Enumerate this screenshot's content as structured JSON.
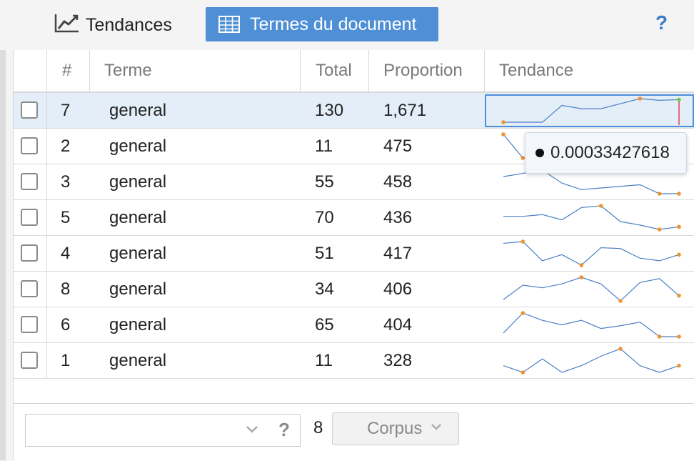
{
  "toolbar": {
    "trend_tab_label": "Tendances",
    "terms_tab_label": "Termes du document",
    "help_label": "?"
  },
  "grid": {
    "columns": [
      "#",
      "Terme",
      "Total",
      "Proportion",
      "Tendance"
    ],
    "rows": [
      {
        "index": "7",
        "term": "general",
        "total": "130",
        "proportion": "1,671",
        "selected": true,
        "trend": [
          0.0002,
          0.0002,
          0.0002,
          0.0003,
          0.00028,
          0.00028,
          0.00031,
          0.00034,
          0.00033,
          0.000334
        ]
      },
      {
        "index": "2",
        "term": "general",
        "total": "11",
        "proportion": "475",
        "selected": false,
        "trend": [
          0.00045,
          0.00025,
          0.0003,
          0.00032,
          0.00031,
          0.0003,
          0.00031,
          0.00032,
          0.00031,
          0.00031
        ]
      },
      {
        "index": "3",
        "term": "general",
        "total": "55",
        "proportion": "458",
        "selected": false,
        "trend": [
          0.00036,
          0.0004,
          0.00044,
          0.00028,
          0.0002,
          0.00022,
          0.00024,
          0.00026,
          0.00015,
          0.00015
        ]
      },
      {
        "index": "5",
        "term": "general",
        "total": "70",
        "proportion": "436",
        "selected": false,
        "trend": [
          0.0003,
          0.0003,
          0.00032,
          0.00026,
          0.0004,
          0.00042,
          0.00024,
          0.0002,
          0.00015,
          0.00018
        ]
      },
      {
        "index": "4",
        "term": "general",
        "total": "51",
        "proportion": "417",
        "selected": false,
        "trend": [
          0.00035,
          0.00037,
          0.00015,
          0.00022,
          0.0001,
          0.0003,
          0.00029,
          0.00018,
          0.00015,
          0.00022
        ]
      },
      {
        "index": "8",
        "term": "general",
        "total": "34",
        "proportion": "406",
        "selected": false,
        "trend": [
          0.00012,
          0.00034,
          0.0003,
          0.00036,
          0.00046,
          0.00036,
          0.0001,
          0.00038,
          0.00044,
          0.00018
        ]
      },
      {
        "index": "6",
        "term": "general",
        "total": "65",
        "proportion": "404",
        "selected": false,
        "trend": [
          0.00022,
          0.00044,
          0.00036,
          0.00031,
          0.00036,
          0.00027,
          0.0003,
          0.00034,
          0.00018,
          0.00018
        ]
      },
      {
        "index": "1",
        "term": "general",
        "total": "11",
        "proportion": "328",
        "selected": false,
        "trend": [
          0.0003,
          0.0002,
          0.0004,
          0.0002,
          0.0003,
          0.00044,
          0.00055,
          0.0003,
          0.0002,
          0.0003
        ]
      }
    ]
  },
  "tooltip": {
    "value": "0.00033427618"
  },
  "footer": {
    "search_value": "",
    "help_label": "?",
    "count": "8",
    "corpus_label": "Corpus"
  },
  "colors": {
    "accent": "#4f8fd6",
    "spark_line": "#4a7fc4",
    "spark_point": "#f0922e",
    "last_point_selected": "#6ccf4a",
    "marker_selected": "#e04545",
    "selected_row": "#e4eef8"
  },
  "icons": {
    "trend_tab": "line-chart-icon",
    "terms_tab": "table-grid-icon",
    "combo_chevron": "chevron-down-icon",
    "corpus_chevron": "chevron-down-icon"
  }
}
